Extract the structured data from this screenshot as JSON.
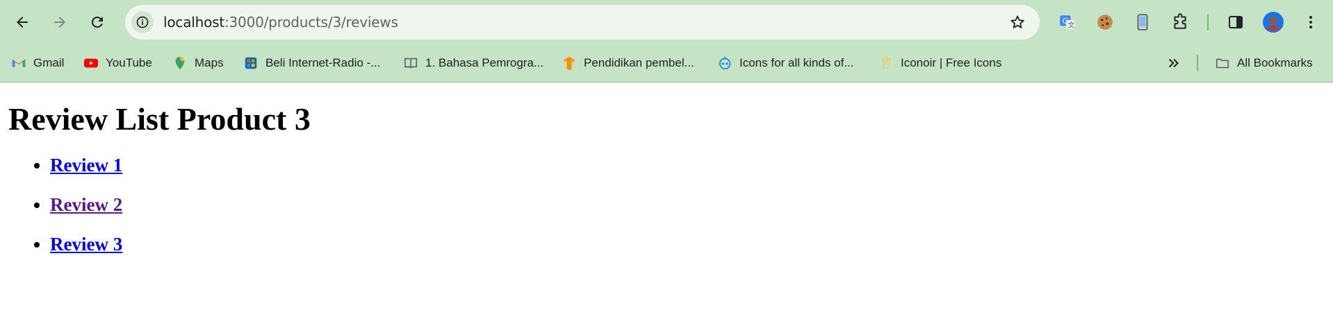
{
  "browser": {
    "url_host": "localhost",
    "url_path": ":3000/products/3/reviews",
    "bookmarks": [
      {
        "label": "Gmail",
        "icon": "gmail-icon"
      },
      {
        "label": "YouTube",
        "icon": "youtube-icon"
      },
      {
        "label": "Maps",
        "icon": "maps-icon"
      },
      {
        "label": "Beli Internet-Radio -...",
        "icon": "store-icon"
      },
      {
        "label": "1. Bahasa Pemrogra...",
        "icon": "book-icon"
      },
      {
        "label": "Pendidikan pembel...",
        "icon": "tensorflow-icon"
      },
      {
        "label": "Icons for all kinds of...",
        "icon": "robot-icon"
      },
      {
        "label": "Iconoir | Free Icons",
        "icon": "hand-icon"
      }
    ],
    "all_bookmarks": "All Bookmarks"
  },
  "page": {
    "title": "Review List Product 3",
    "reviews": [
      {
        "label": "Review 1",
        "visited": false
      },
      {
        "label": "Review 2",
        "visited": true
      },
      {
        "label": "Review 3",
        "visited": false
      }
    ]
  },
  "colors": {
    "chrome_bg": "#c5e3c5",
    "link": "#0000ee",
    "visited_link": "#551a8b"
  }
}
